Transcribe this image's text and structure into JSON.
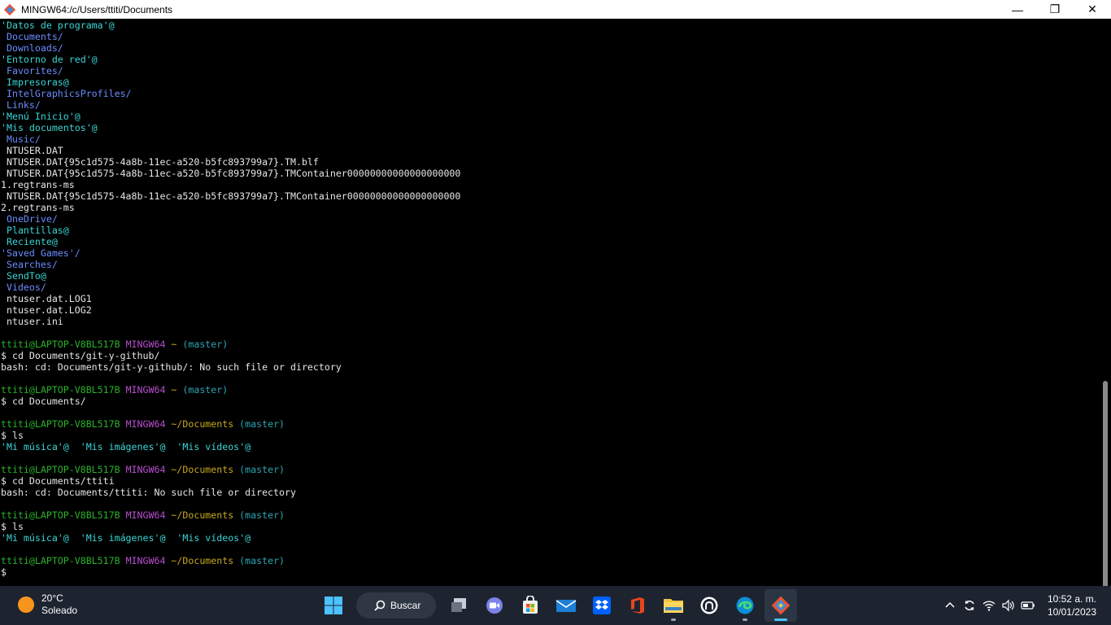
{
  "window": {
    "title": "MINGW64:/c/Users/ttiti/Documents",
    "minimize": "—",
    "maximize": "❐",
    "close": "✕"
  },
  "terminal": {
    "lines": [
      [
        {
          "t": "'Datos de programa'@",
          "c": "link"
        }
      ],
      [
        {
          "t": " Documents/",
          "c": "dir"
        }
      ],
      [
        {
          "t": " Downloads/",
          "c": "dir"
        }
      ],
      [
        {
          "t": "'Entorno de red'@",
          "c": "link"
        }
      ],
      [
        {
          "t": " Favorites/",
          "c": "dir"
        }
      ],
      [
        {
          "t": " Impresoras@",
          "c": "link"
        }
      ],
      [
        {
          "t": " IntelGraphicsProfiles/",
          "c": "dir"
        }
      ],
      [
        {
          "t": " Links/",
          "c": "dir"
        }
      ],
      [
        {
          "t": "'Menú Inicio'@",
          "c": "link"
        }
      ],
      [
        {
          "t": "'Mis documentos'@",
          "c": "link"
        }
      ],
      [
        {
          "t": " Music/",
          "c": "dir"
        }
      ],
      [
        {
          "t": " NTUSER.DAT",
          "c": "plain"
        }
      ],
      [
        {
          "t": " NTUSER.DAT{95c1d575-4a8b-11ec-a520-b5fc893799a7}.TM.blf",
          "c": "plain"
        }
      ],
      [
        {
          "t": " NTUSER.DAT{95c1d575-4a8b-11ec-a520-b5fc893799a7}.TMContainer00000000000000000000",
          "c": "plain"
        }
      ],
      [
        {
          "t": "1.regtrans-ms",
          "c": "plain"
        }
      ],
      [
        {
          "t": " NTUSER.DAT{95c1d575-4a8b-11ec-a520-b5fc893799a7}.TMContainer00000000000000000000",
          "c": "plain"
        }
      ],
      [
        {
          "t": "2.regtrans-ms",
          "c": "plain"
        }
      ],
      [
        {
          "t": " OneDrive/",
          "c": "dir"
        }
      ],
      [
        {
          "t": " Plantillas@",
          "c": "link"
        }
      ],
      [
        {
          "t": " Reciente@",
          "c": "link"
        }
      ],
      [
        {
          "t": "'Saved Games'/",
          "c": "dir"
        }
      ],
      [
        {
          "t": " Searches/",
          "c": "dir"
        }
      ],
      [
        {
          "t": " SendTo@",
          "c": "link"
        }
      ],
      [
        {
          "t": " Videos/",
          "c": "dir"
        }
      ],
      [
        {
          "t": " ntuser.dat.LOG1",
          "c": "plain"
        }
      ],
      [
        {
          "t": " ntuser.dat.LOG2",
          "c": "plain"
        }
      ],
      [
        {
          "t": " ntuser.ini",
          "c": "plain"
        }
      ],
      [],
      [
        {
          "t": "ttiti@LAPTOP-V8BL517B",
          "c": "user"
        },
        {
          "t": " MINGW64",
          "c": "host"
        },
        {
          "t": " ~",
          "c": "path"
        },
        {
          "t": " (master)",
          "c": "branch"
        }
      ],
      [
        {
          "t": "$ cd Documents/git-y-github/",
          "c": "plain"
        }
      ],
      [
        {
          "t": "bash: cd: Documents/git-y-github/: No such file or directory",
          "c": "plain"
        }
      ],
      [],
      [
        {
          "t": "ttiti@LAPTOP-V8BL517B",
          "c": "user"
        },
        {
          "t": " MINGW64",
          "c": "host"
        },
        {
          "t": " ~",
          "c": "path"
        },
        {
          "t": " (master)",
          "c": "branch"
        }
      ],
      [
        {
          "t": "$ cd Documents/",
          "c": "plain"
        }
      ],
      [],
      [
        {
          "t": "ttiti@LAPTOP-V8BL517B",
          "c": "user"
        },
        {
          "t": " MINGW64",
          "c": "host"
        },
        {
          "t": " ~/Documents",
          "c": "path"
        },
        {
          "t": " (master)",
          "c": "branch"
        }
      ],
      [
        {
          "t": "$ ls",
          "c": "plain"
        }
      ],
      [
        {
          "t": "'Mi música'@  'Mis imágenes'@  'Mis vídeos'@",
          "c": "link"
        }
      ],
      [],
      [
        {
          "t": "ttiti@LAPTOP-V8BL517B",
          "c": "user"
        },
        {
          "t": " MINGW64",
          "c": "host"
        },
        {
          "t": " ~/Documents",
          "c": "path"
        },
        {
          "t": " (master)",
          "c": "branch"
        }
      ],
      [
        {
          "t": "$ cd Documents/ttiti",
          "c": "plain"
        }
      ],
      [
        {
          "t": "bash: cd: Documents/ttiti: No such file or directory",
          "c": "plain"
        }
      ],
      [],
      [
        {
          "t": "ttiti@LAPTOP-V8BL517B",
          "c": "user"
        },
        {
          "t": " MINGW64",
          "c": "host"
        },
        {
          "t": " ~/Documents",
          "c": "path"
        },
        {
          "t": " (master)",
          "c": "branch"
        }
      ],
      [
        {
          "t": "$ ls",
          "c": "plain"
        }
      ],
      [
        {
          "t": "'Mi música'@  'Mis imágenes'@  'Mis vídeos'@",
          "c": "link"
        }
      ],
      [],
      [
        {
          "t": "ttiti@LAPTOP-V8BL517B",
          "c": "user"
        },
        {
          "t": " MINGW64",
          "c": "host"
        },
        {
          "t": " ~/Documents",
          "c": "path"
        },
        {
          "t": " (master)",
          "c": "branch"
        }
      ],
      [
        {
          "t": "$",
          "c": "plain"
        }
      ]
    ]
  },
  "taskbar": {
    "weather": {
      "temp": "20°C",
      "condition": "Soleado"
    },
    "search_label": "Buscar",
    "apps": [
      {
        "name": "start-button",
        "icon": "windows-logo-icon"
      },
      {
        "name": "search"
      },
      {
        "name": "task-view-button",
        "icon": "task-view-icon"
      },
      {
        "name": "teams-chat-button",
        "icon": "video-chat-icon"
      },
      {
        "name": "store-button",
        "icon": "store-icon"
      },
      {
        "name": "mail-button",
        "icon": "mail-icon"
      },
      {
        "name": "dropbox-button",
        "icon": "dropbox-icon"
      },
      {
        "name": "office-button",
        "icon": "office-icon"
      },
      {
        "name": "file-explorer-button",
        "icon": "folder-icon"
      },
      {
        "name": "github-desktop-button",
        "icon": "github-icon"
      },
      {
        "name": "edge-button",
        "icon": "edge-icon"
      },
      {
        "name": "git-bash-button",
        "icon": "git-icon"
      }
    ],
    "clock": {
      "time": "10:52 a. m.",
      "date": "10/01/2023"
    }
  },
  "colors": {
    "dir": "#6b8cff",
    "link": "#3ad4d4",
    "user": "#2ab32a",
    "host": "#b84fcf",
    "path": "#c7a81e",
    "branch": "#2aa6b3",
    "taskbar": "#1d2430",
    "accent": "#4cc2ff"
  }
}
